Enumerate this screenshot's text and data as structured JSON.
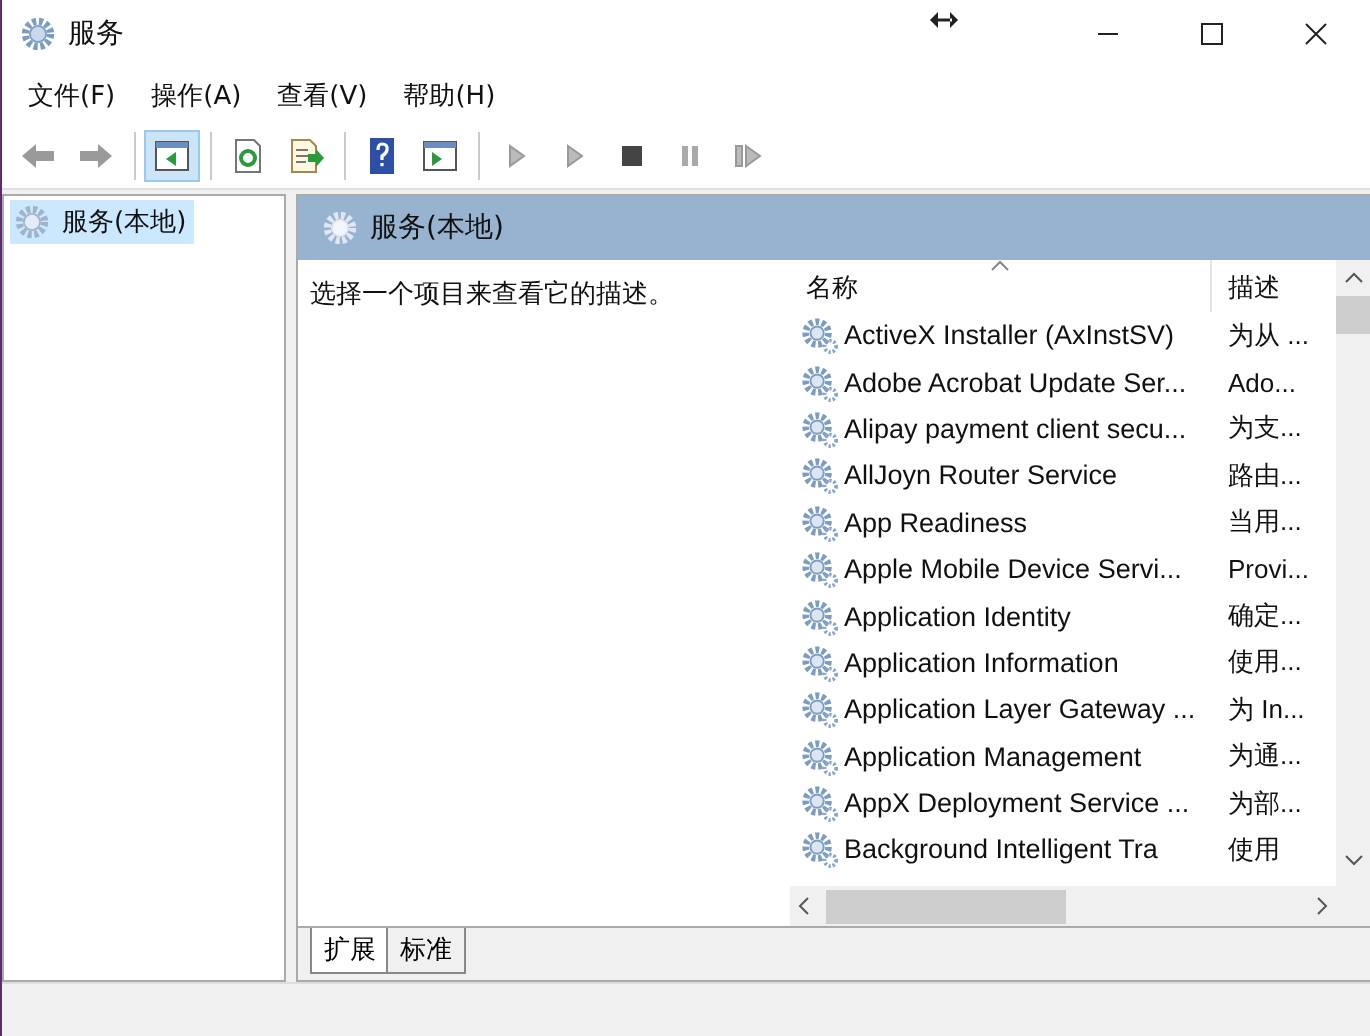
{
  "window": {
    "title": "服务"
  },
  "menu": [
    "文件(F)",
    "操作(A)",
    "查看(V)",
    "帮助(H)"
  ],
  "toolbar": [
    [
      {
        "kind": "back",
        "pressed": false
      },
      {
        "kind": "forward",
        "pressed": false
      }
    ],
    [
      {
        "kind": "tree",
        "pressed": true
      }
    ],
    [
      {
        "kind": "refresh",
        "pressed": false
      },
      {
        "kind": "export",
        "pressed": false
      }
    ],
    [
      {
        "kind": "help",
        "pressed": false
      },
      {
        "kind": "panel",
        "pressed": false
      }
    ],
    [
      {
        "kind": "play",
        "pressed": false
      },
      {
        "kind": "play",
        "pressed": false
      },
      {
        "kind": "stop",
        "pressed": false
      },
      {
        "kind": "pause",
        "pressed": false
      },
      {
        "kind": "resume",
        "pressed": false
      }
    ]
  ],
  "tree": [
    {
      "label": "服务(本地)",
      "selected": true
    }
  ],
  "panel": {
    "title": "服务(本地)",
    "description": "选择一个项目来查看它的描述。"
  },
  "table": {
    "columns": [
      "名称",
      "描述"
    ],
    "rows": [
      {
        "name": "ActiveX Installer (AxInstSV)",
        "description": "为从 ..."
      },
      {
        "name": "Adobe Acrobat Update Ser...",
        "description": "Ado..."
      },
      {
        "name": "Alipay payment client secu...",
        "description": "为支..."
      },
      {
        "name": "AllJoyn Router Service",
        "description": "路由..."
      },
      {
        "name": "App Readiness",
        "description": "当用..."
      },
      {
        "name": "Apple Mobile Device Servi...",
        "description": "Provi..."
      },
      {
        "name": "Application Identity",
        "description": "确定..."
      },
      {
        "name": "Application Information",
        "description": "使用..."
      },
      {
        "name": "Application Layer Gateway ...",
        "description": "为 In..."
      },
      {
        "name": "Application Management",
        "description": "为通..."
      },
      {
        "name": "AppX Deployment Service ...",
        "description": "为部..."
      },
      {
        "name": "Background Intelligent Tra",
        "description": "使用"
      }
    ]
  },
  "tabs": [
    {
      "label": "扩展",
      "selected": true
    },
    {
      "label": "标准",
      "selected": false
    }
  ]
}
